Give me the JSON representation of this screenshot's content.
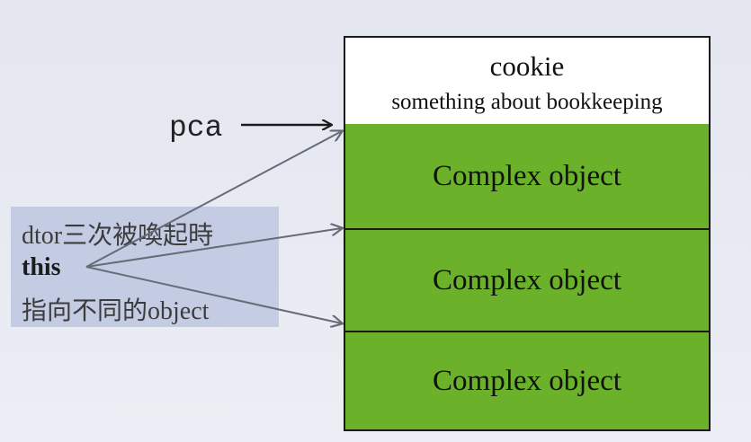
{
  "header": {
    "title": "cookie",
    "subtitle": "something about bookkeeping"
  },
  "objects": [
    {
      "label": "Complex object"
    },
    {
      "label": "Complex object"
    },
    {
      "label": "Complex object"
    }
  ],
  "pointer": {
    "label": "pca"
  },
  "note": {
    "line1": "dtor三次被喚起時",
    "line2": "this",
    "line3": "指向不同的object"
  },
  "colors": {
    "object_fill": "#6bb22a",
    "note_fill": "#c2cbe3",
    "arrow": "#666b78"
  }
}
